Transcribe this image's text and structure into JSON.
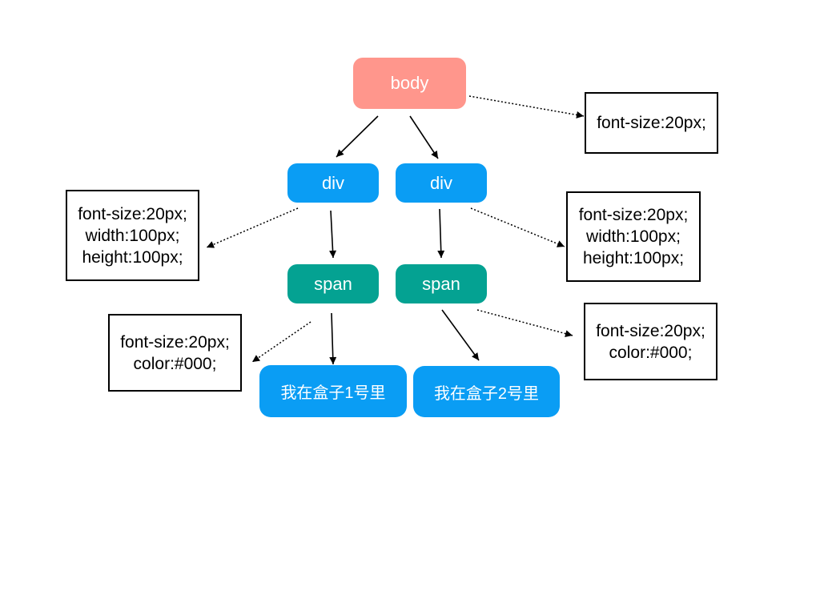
{
  "colors": {
    "background": "#FFFFFF",
    "body_node": "#FF968C",
    "div_node": "#0A9DF4",
    "span_node": "#04A292",
    "text_node": "#0A9DF4",
    "node_text": "#FFFFFF",
    "style_box_border": "#000000",
    "style_text": "#000000",
    "arrow": "#000000"
  },
  "tree": {
    "body": {
      "label": "body",
      "styles": [
        "font-size:20px;"
      ]
    },
    "branches": [
      {
        "div": {
          "label": "div",
          "styles": [
            "font-size:20px;",
            "width:100px;",
            "height:100px;"
          ]
        },
        "span": {
          "label": "span",
          "styles": [
            "font-size:20px;",
            "color:#000;"
          ]
        },
        "text": "我在盒子1号里"
      },
      {
        "div": {
          "label": "div",
          "styles": [
            "font-size:20px;",
            "width:100px;",
            "height:100px;"
          ]
        },
        "span": {
          "label": "span",
          "styles": [
            "font-size:20px;",
            "color:#000;"
          ]
        },
        "text": "我在盒子2号里"
      }
    ]
  }
}
